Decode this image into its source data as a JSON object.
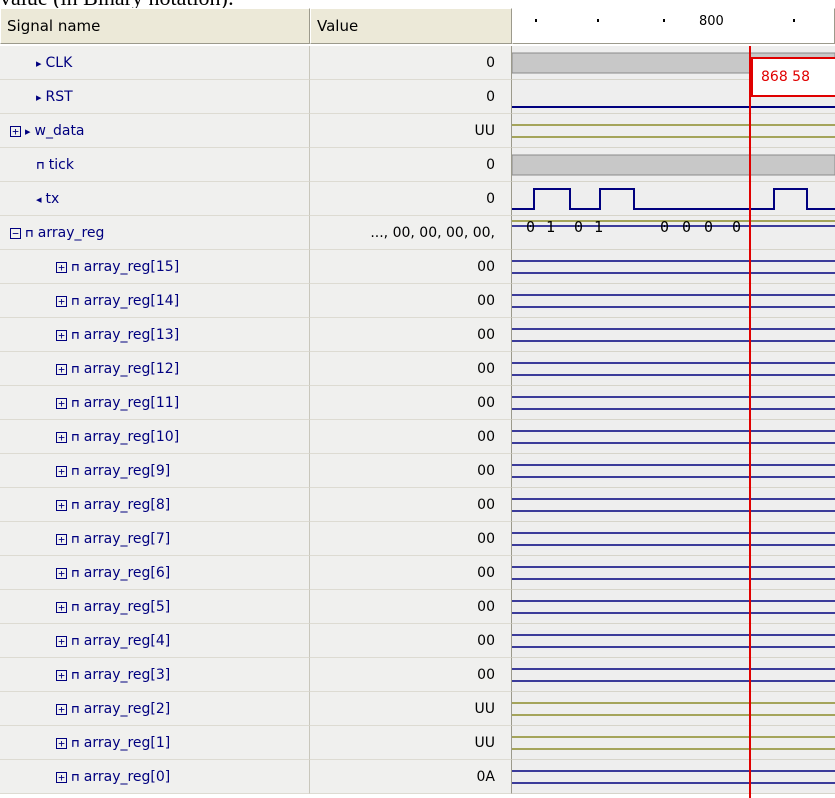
{
  "caption": "value (in Binary notation):",
  "header": {
    "signal_name": "Signal name",
    "value": "Value",
    "ruler_label": "800"
  },
  "cursor": {
    "label": "868 58"
  },
  "colors": {
    "cursor": "#e00000",
    "wave_blue": "#00007f",
    "wave_olive": "#8b8b2a",
    "grey_bus": "#c8c8c8"
  },
  "signals": [
    {
      "name": "CLK",
      "icon": "input-port-icon",
      "expander": "",
      "value": "0"
    },
    {
      "name": "RST",
      "icon": "input-port-icon",
      "expander": "",
      "value": "0"
    },
    {
      "name": "w_data",
      "icon": "input-port-icon",
      "expander": "+",
      "value": "UU"
    },
    {
      "name": "tick",
      "icon": "internal-signal-icon",
      "expander": "",
      "value": "0"
    },
    {
      "name": "tx",
      "icon": "output-port-icon",
      "expander": "",
      "value": "0"
    },
    {
      "name": "array_reg",
      "icon": "internal-signal-icon",
      "expander": "−",
      "value": "..., 00, 00, 00, 00,"
    },
    {
      "name": "array_reg[15]",
      "icon": "internal-signal-icon",
      "expander": "+",
      "value": "00"
    },
    {
      "name": "array_reg[14]",
      "icon": "internal-signal-icon",
      "expander": "+",
      "value": "00"
    },
    {
      "name": "array_reg[13]",
      "icon": "internal-signal-icon",
      "expander": "+",
      "value": "00"
    },
    {
      "name": "array_reg[12]",
      "icon": "internal-signal-icon",
      "expander": "+",
      "value": "00"
    },
    {
      "name": "array_reg[11]",
      "icon": "internal-signal-icon",
      "expander": "+",
      "value": "00"
    },
    {
      "name": "array_reg[10]",
      "icon": "internal-signal-icon",
      "expander": "+",
      "value": "00"
    },
    {
      "name": "array_reg[9]",
      "icon": "internal-signal-icon",
      "expander": "+",
      "value": "00"
    },
    {
      "name": "array_reg[8]",
      "icon": "internal-signal-icon",
      "expander": "+",
      "value": "00"
    },
    {
      "name": "array_reg[7]",
      "icon": "internal-signal-icon",
      "expander": "+",
      "value": "00"
    },
    {
      "name": "array_reg[6]",
      "icon": "internal-signal-icon",
      "expander": "+",
      "value": "00"
    },
    {
      "name": "array_reg[5]",
      "icon": "internal-signal-icon",
      "expander": "+",
      "value": "00"
    },
    {
      "name": "array_reg[4]",
      "icon": "internal-signal-icon",
      "expander": "+",
      "value": "00"
    },
    {
      "name": "array_reg[3]",
      "icon": "internal-signal-icon",
      "expander": "+",
      "value": "00"
    },
    {
      "name": "array_reg[2]",
      "icon": "internal-signal-icon",
      "expander": "+",
      "value": "UU"
    },
    {
      "name": "array_reg[1]",
      "icon": "internal-signal-icon",
      "expander": "+",
      "value": "UU"
    },
    {
      "name": "array_reg[0]",
      "icon": "internal-signal-icon",
      "expander": "+",
      "value": "0A"
    }
  ],
  "array_reg_wave_labels": [
    "0",
    "1",
    "0",
    "1",
    "0",
    "0",
    "0",
    "0"
  ]
}
